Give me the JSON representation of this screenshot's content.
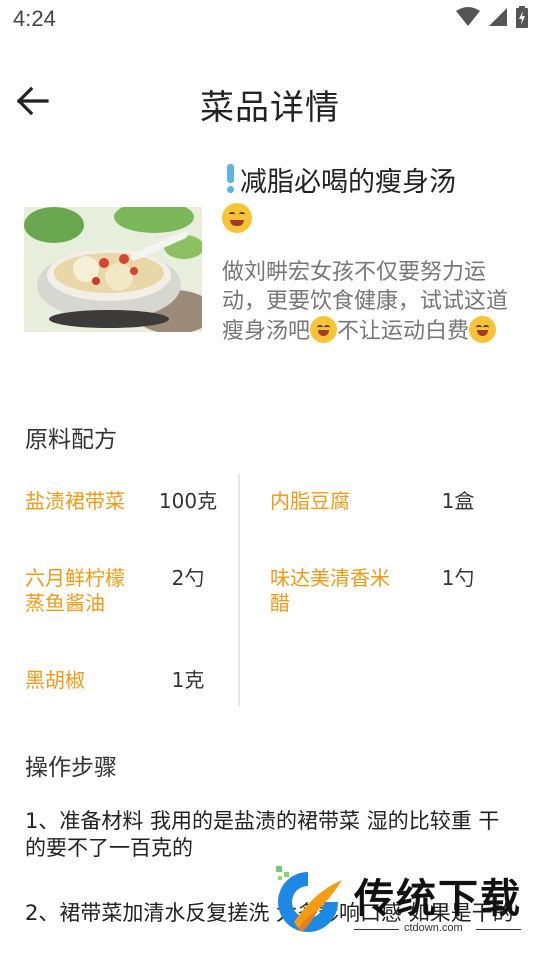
{
  "status_bar": {
    "time": "4:24",
    "icons": [
      "wifi-icon",
      "signal-icon",
      "battery-charging-icon"
    ]
  },
  "app_bar": {
    "title": "菜品详情",
    "back_icon": "arrow-left-icon"
  },
  "dish": {
    "title": "减脂必喝的瘦身汤",
    "description_parts": [
      "做刘畊宏女孩不仅要努力运动，更要饮食健康，试试这道瘦身汤吧",
      "不让运动白费"
    ]
  },
  "ingredients": {
    "heading": "原料配方",
    "items": [
      {
        "name": "盐渍裙带菜",
        "qty": "100克"
      },
      {
        "name": "内脂豆腐",
        "qty": "1盒"
      },
      {
        "name": "六月鲜柠檬蒸鱼酱油",
        "qty": "2勺"
      },
      {
        "name": "味达美清香米醋",
        "qty": "1勺"
      },
      {
        "name": "黑胡椒",
        "qty": "1克"
      }
    ]
  },
  "steps": {
    "heading": "操作步骤",
    "items": [
      "1、准备材料 我用的是盐渍的裙带菜 湿的比较重 干的要不了一百克的",
      "2、裙带菜加清水反复搓洗 太多影响口感 如果是干的"
    ]
  },
  "watermark": {
    "brand": "传统下载",
    "url": "ctdown.com"
  },
  "colors": {
    "ingredient_name": "#f29a16",
    "description": "#777777",
    "accent_blue": "#1e88e5"
  }
}
